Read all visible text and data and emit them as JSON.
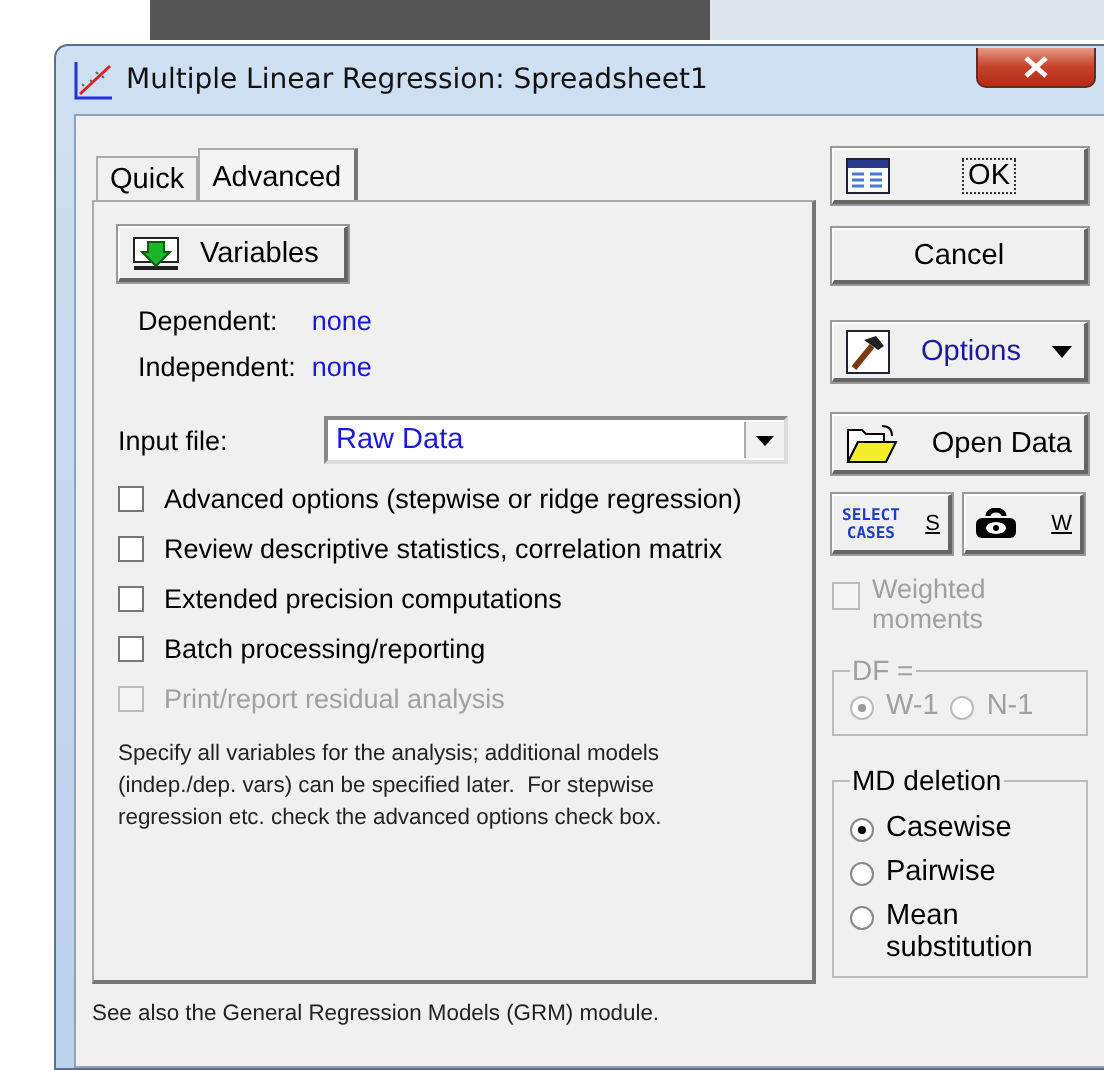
{
  "window": {
    "title": "Multiple Linear Regression: Spreadsheet1"
  },
  "tabs": [
    {
      "label": "Quick",
      "selected": false
    },
    {
      "label": "Advanced",
      "selected": true
    }
  ],
  "variables_button": {
    "label": "Variables"
  },
  "variables": [
    {
      "label": "Dependent:",
      "value": "none"
    },
    {
      "label": "Independent:",
      "value": "none"
    }
  ],
  "input_file": {
    "label": "Input file:",
    "value": "Raw Data"
  },
  "options": [
    {
      "label": "Advanced options (stepwise or ridge regression)",
      "checked": false,
      "disabled": false
    },
    {
      "label": "Review descriptive statistics, correlation matrix",
      "checked": false,
      "disabled": false
    },
    {
      "label": "Extended precision computations",
      "checked": false,
      "disabled": false
    },
    {
      "label": "Batch processing/reporting",
      "checked": false,
      "disabled": false
    },
    {
      "label": "Print/report residual analysis",
      "checked": false,
      "disabled": true
    }
  ],
  "hint": "Specify all variables for the analysis; additional models (indep./dep. vars) can be specified later.  For stepwise regression etc. check the advanced options check box.",
  "footer": "See also the General Regression Models (GRM) module.",
  "buttons": [
    {
      "label": "OK",
      "kind": "ok"
    },
    {
      "label": "Cancel",
      "kind": "plain"
    },
    {
      "label": "Options",
      "kind": "menu"
    },
    {
      "label": "Open Data",
      "kind": "open"
    }
  ],
  "select_cases_button": {
    "icon_lines": [
      "SELECT",
      "CASES"
    ],
    "label": "S"
  },
  "weight_button": {
    "label": "W"
  },
  "weighted_moments": {
    "label": "Weighted moments",
    "checked": false,
    "disabled": true
  },
  "df_group": {
    "title": "DF =",
    "disabled": true,
    "options": [
      {
        "label": "W-1",
        "selected": true
      },
      {
        "label": "N-1",
        "selected": false
      }
    ]
  },
  "md_deletion": {
    "title": "MD deletion",
    "options": [
      {
        "label": "Casewise",
        "selected": true
      },
      {
        "label": "Pairwise",
        "selected": false
      },
      {
        "label": "Mean substitution",
        "selected": false
      }
    ]
  }
}
